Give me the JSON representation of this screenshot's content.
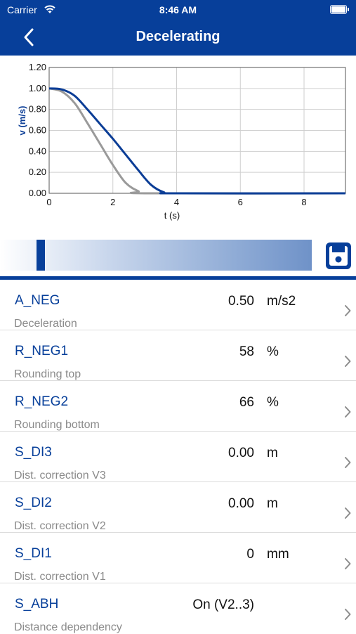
{
  "status": {
    "carrier": "Carrier",
    "time": "8:46 AM"
  },
  "nav": {
    "title": "Decelerating"
  },
  "icons": {
    "back": "back-chevron-icon",
    "save": "floppy-disk-icon",
    "row_chevron": "chevron-right-icon",
    "wifi": "wifi-icon",
    "battery": "battery-icon"
  },
  "colors": {
    "accent": "#073f9a",
    "curve_primary": "#0b3d96",
    "curve_secondary": "#9a9a9a"
  },
  "slider": {
    "position": 0.13
  },
  "chart_data": {
    "type": "line",
    "xlabel": "t (s)",
    "ylabel": "v (m/s)",
    "xlim": [
      0,
      9.3
    ],
    "ylim": [
      0,
      1.2
    ],
    "xticks": [
      "0",
      "2",
      "4",
      "6",
      "8"
    ],
    "xtick_values": [
      0,
      2,
      4,
      6,
      8
    ],
    "yticks": [
      "0.00",
      "0.20",
      "0.40",
      "0.60",
      "0.80",
      "1.00",
      "1.20"
    ],
    "ytick_values": [
      0,
      0.2,
      0.4,
      0.6,
      0.8,
      1.0,
      1.2
    ],
    "grid": true,
    "series": [
      {
        "values": [
          [
            0,
            1.0
          ],
          [
            0.4,
            0.99
          ],
          [
            0.8,
            0.93
          ],
          [
            1.2,
            0.8
          ],
          [
            1.6,
            0.66
          ],
          [
            2.0,
            0.52
          ],
          [
            2.4,
            0.37
          ],
          [
            2.8,
            0.22
          ],
          [
            3.2,
            0.08
          ],
          [
            3.6,
            0.01
          ],
          [
            4.0,
            0.0
          ],
          [
            9.3,
            0.0
          ]
        ]
      },
      {
        "values": [
          [
            0,
            1.0
          ],
          [
            0.4,
            0.97
          ],
          [
            0.8,
            0.86
          ],
          [
            1.2,
            0.67
          ],
          [
            1.6,
            0.47
          ],
          [
            2.0,
            0.27
          ],
          [
            2.4,
            0.1
          ],
          [
            2.8,
            0.02
          ],
          [
            3.1,
            0.0
          ],
          [
            9.3,
            0.0
          ]
        ]
      }
    ]
  },
  "rows": [
    {
      "name": "A_NEG",
      "desc": "Deceleration",
      "value": "0.50",
      "unit": "m/s2"
    },
    {
      "name": "R_NEG1",
      "desc": "Rounding top",
      "value": "58",
      "unit": "%"
    },
    {
      "name": "R_NEG2",
      "desc": "Rounding bottom",
      "value": "66",
      "unit": "%"
    },
    {
      "name": "S_DI3",
      "desc": "Dist. correction V3",
      "value": "0.00",
      "unit": "m"
    },
    {
      "name": "S_DI2",
      "desc": "Dist. correction V2",
      "value": "0.00",
      "unit": "m"
    },
    {
      "name": "S_DI1",
      "desc": "Dist. correction V1",
      "value": "0",
      "unit": "mm"
    },
    {
      "name": "S_ABH",
      "desc": "Distance dependency",
      "value": "On (V2..3)",
      "unit": ""
    }
  ]
}
